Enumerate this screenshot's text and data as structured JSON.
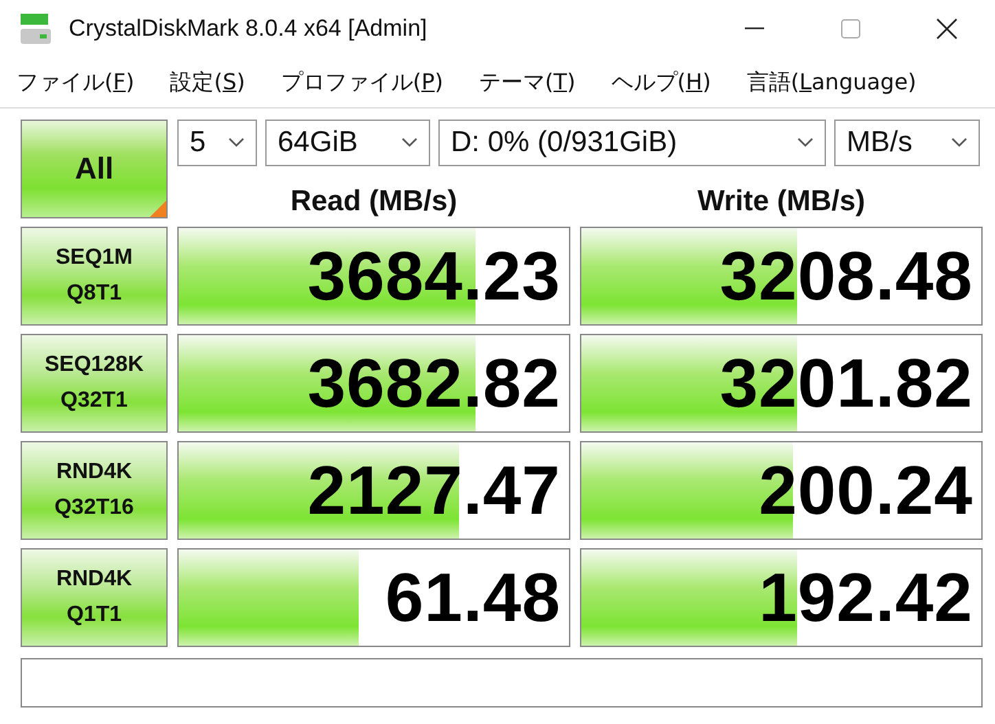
{
  "window": {
    "title": "CrystalDiskMark 8.0.4 x64 [Admin]"
  },
  "menu": [
    {
      "before": "ファイル(",
      "accel": "F",
      "after": ")"
    },
    {
      "before": "設定(",
      "accel": "S",
      "after": ")"
    },
    {
      "before": "プロファイル(",
      "accel": "P",
      "after": ")"
    },
    {
      "before": "テーマ(",
      "accel": "T",
      "after": ")"
    },
    {
      "before": "ヘルプ(",
      "accel": "H",
      "after": ")"
    },
    {
      "before": "言語(",
      "accel": "L",
      "after": "anguage)"
    }
  ],
  "all_button": "All",
  "selects": [
    {
      "kind": "count",
      "value": "5"
    },
    {
      "kind": "size",
      "value": "64GiB"
    },
    {
      "kind": "drive",
      "value": "D: 0% (0/931GiB)"
    },
    {
      "kind": "unit",
      "value": "MB/s"
    }
  ],
  "headers": [
    "Read (MB/s)",
    "Write (MB/s)"
  ],
  "tests": [
    {
      "line1": "SEQ1M",
      "line2": "Q8T1",
      "read": {
        "value": "3684.23",
        "level": 0.76
      },
      "write": {
        "value": "3208.48",
        "level": 0.54
      }
    },
    {
      "line1": "SEQ128K",
      "line2": "Q32T1",
      "read": {
        "value": "3682.82",
        "level": 0.76
      },
      "write": {
        "value": "3201.82",
        "level": 0.54
      }
    },
    {
      "line1": "RND4K",
      "line2": "Q32T16",
      "read": {
        "value": "2127.47",
        "level": 0.72
      },
      "write": {
        "value": "200.24",
        "level": 0.53
      }
    },
    {
      "line1": "RND4K",
      "line2": "Q1T1",
      "read": {
        "value": "61.48",
        "level": 0.46
      },
      "write": {
        "value": "192.42",
        "level": 0.54
      }
    }
  ]
}
